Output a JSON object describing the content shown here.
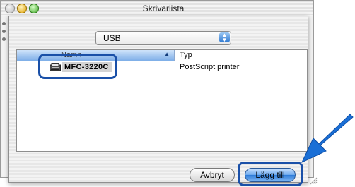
{
  "window": {
    "title": "Skrivarlista"
  },
  "sheet": {
    "connection_popup": {
      "value": "USB"
    },
    "list": {
      "columns": [
        {
          "label": "Namn",
          "sort": "ascending"
        },
        {
          "label": "Typ"
        }
      ],
      "rows": [
        {
          "name": "MFC-3220C",
          "type": "PostScript printer",
          "icon": "printer-icon",
          "selected": true
        }
      ]
    },
    "buttons": {
      "cancel_label": "Avbryt",
      "add_label": "Lägg till"
    }
  },
  "annotations": {
    "highlight_color": "#1a50a8",
    "arrow_color": "#1a6fd6"
  }
}
